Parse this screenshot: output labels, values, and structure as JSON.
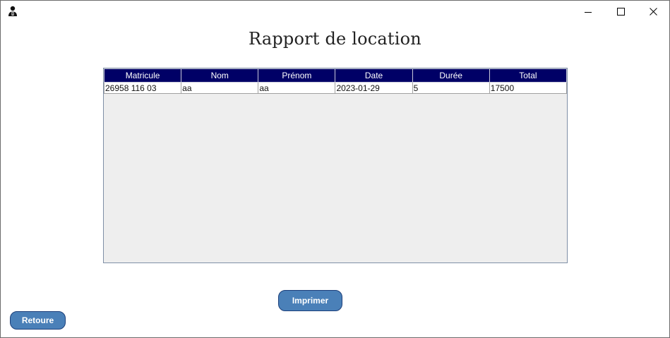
{
  "window": {
    "controls": {
      "minimize_icon": "minimize-icon",
      "maximize_icon": "maximize-icon",
      "close_icon": "close-icon"
    },
    "app_icon": "user-icon"
  },
  "page": {
    "title": "Rapport de location"
  },
  "table": {
    "headers": [
      "Matricule",
      "Nom",
      "Prénom",
      "Date",
      "Durée",
      "Total"
    ],
    "rows": [
      [
        "26958 116 03",
        "aa",
        "aa",
        "2023-01-29",
        "5",
        "17500"
      ]
    ]
  },
  "buttons": {
    "print_label": "Imprimer",
    "back_label": "Retoure"
  },
  "colors": {
    "header_bg": "#000066",
    "button_bg": "#4a80b8",
    "table_bg": "#eeeeee"
  }
}
